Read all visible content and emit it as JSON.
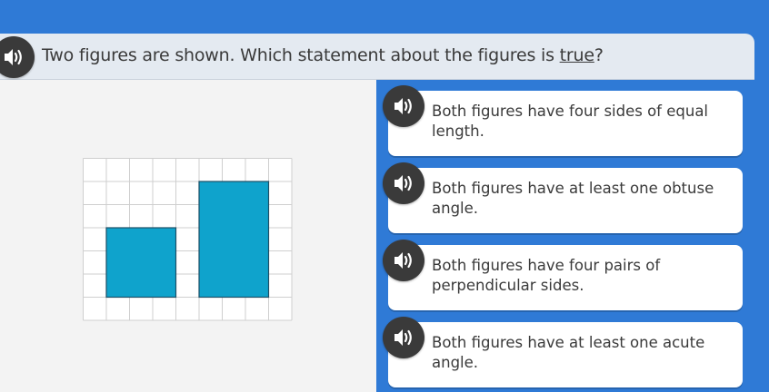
{
  "question": {
    "text_before": "Two figures are shown. Which statement about the figures is ",
    "emphasis": "true",
    "text_after": "?"
  },
  "figure": {
    "grid_cols": 9,
    "grid_rows": 7,
    "fill_color": "#0fa3cc",
    "shapes": [
      {
        "name": "square",
        "width_units": 3,
        "height_units": 3
      },
      {
        "name": "rectangle",
        "width_units": 3,
        "height_units": 5
      }
    ]
  },
  "answers": [
    {
      "text": "Both figures have four sides of equal length."
    },
    {
      "text": "Both figures have at least one obtuse angle."
    },
    {
      "text": "Both figures have four pairs of perpendicular sides."
    },
    {
      "text": "Both figures have at least one acute angle."
    }
  ],
  "icons": {
    "speaker": "speaker-icon"
  },
  "colors": {
    "background": "#2f7ad6",
    "question_bar": "#e4eaf1",
    "speaker_button": "#3a3a3a"
  }
}
